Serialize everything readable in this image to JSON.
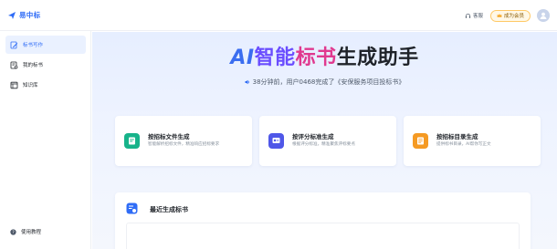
{
  "app": {
    "name": "易中标"
  },
  "header": {
    "support_label": "客服",
    "member_label": "成为会员"
  },
  "sidebar": {
    "items": [
      {
        "label": "标书写作",
        "active": true
      },
      {
        "label": "我的标书",
        "active": false
      },
      {
        "label": "知识库",
        "active": false
      }
    ],
    "help_label": "使用教程"
  },
  "hero": {
    "title_ai": "AI",
    "title_zn": "智能",
    "title_bs": "标书",
    "title_sc": "生成助手",
    "notice": "38分钟前，用户0468完成了《安保服务项目投标书》"
  },
  "cards": [
    {
      "title": "按招标文件生成",
      "desc": "智能解析招标文件，精准响应招标要求",
      "icon": "document-icon",
      "color": "#17b38a"
    },
    {
      "title": "按评分标准生成",
      "desc": "根据评分标准，精准聚焦评标要点",
      "icon": "scoring-icon",
      "color": "#4f57e8"
    },
    {
      "title": "按招标目录生成",
      "desc": "提供标书目录，AI帮你写正文",
      "icon": "outline-icon",
      "color": "#f59a23"
    }
  ],
  "recent": {
    "title": "最近生成标书",
    "icon": "recent-docs-icon"
  },
  "colors": {
    "primary": "#2f6cf6",
    "active_bg": "#eaf1ff",
    "main_bg": "#e6eeff"
  }
}
